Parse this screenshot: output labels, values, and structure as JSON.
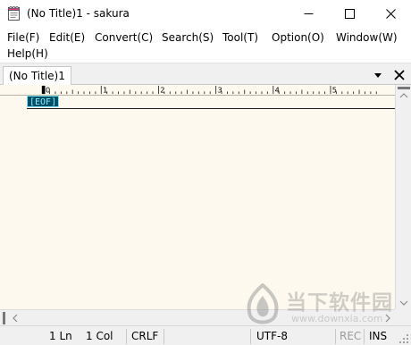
{
  "window": {
    "title": "(No Title)1 - sakura",
    "controls": {
      "minimize": "minimize-icon",
      "maximize": "maximize-icon",
      "close": "close-icon"
    }
  },
  "menu": [
    {
      "label": "File(F)",
      "name": "menu-file"
    },
    {
      "label": "Edit(E)",
      "name": "menu-edit"
    },
    {
      "label": "Convert(C)",
      "name": "menu-convert"
    },
    {
      "label": "Search(S)",
      "name": "menu-search"
    },
    {
      "label": "Tool(T)",
      "name": "menu-tool"
    },
    {
      "label": "Option(O)",
      "name": "menu-option"
    },
    {
      "label": "Window(W)",
      "name": "menu-window"
    },
    {
      "label": "Help(H)",
      "name": "menu-help"
    }
  ],
  "tabs": {
    "active": "(No Title)1",
    "dropdown_icon": "chevron-down-icon",
    "close_icon": "close-icon"
  },
  "ruler": {
    "labels": [
      "0",
      "1",
      "2",
      "3",
      "4",
      "5"
    ]
  },
  "editor": {
    "eof_marker": "[EOF]"
  },
  "status": {
    "line": "1 Ln",
    "column": "1 Col",
    "line_ending": "CRLF",
    "encoding": "UTF-8",
    "rec": "REC",
    "mode": "INS"
  },
  "watermark": {
    "brand": "当下软件园",
    "url": "www.downxia.com"
  },
  "colors": {
    "editor_bg": "#fdf9ee",
    "eof_bg": "#004d66",
    "eof_fg": "#8cf2ff",
    "chrome": "#f0f0f0"
  }
}
